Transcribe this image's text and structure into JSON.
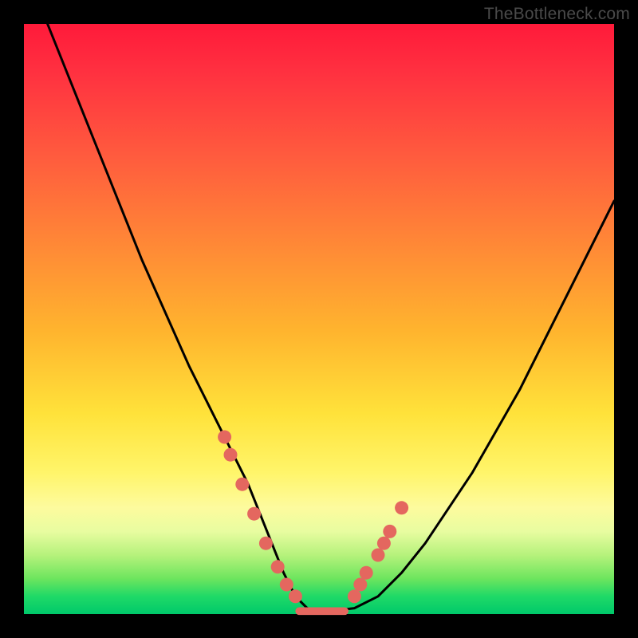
{
  "watermark": "TheBottleneck.com",
  "colors": {
    "frame_bg": "#000000",
    "gradient_top": "#ff1a3a",
    "gradient_bottom": "#00c96a",
    "curve": "#000000",
    "marker_fill": "#e4675f",
    "marker_stroke": "#c94e46",
    "bottom_band": "#e4675f"
  },
  "chart_data": {
    "type": "line",
    "title": "",
    "xlabel": "",
    "ylabel": "",
    "xlim": [
      0,
      100
    ],
    "ylim": [
      0,
      100
    ],
    "grid": false,
    "legend": false,
    "series": [
      {
        "name": "bottleneck-curve",
        "x": [
          4,
          8,
          12,
          16,
          20,
          24,
          28,
          30,
          32,
          34,
          36,
          38,
          40,
          42,
          44,
          46,
          48,
          50,
          52,
          56,
          60,
          64,
          68,
          72,
          76,
          80,
          84,
          88,
          92,
          96,
          100
        ],
        "y": [
          100,
          90,
          80,
          70,
          60,
          51,
          42,
          38,
          34,
          30,
          26,
          22,
          17,
          12,
          7,
          3,
          1,
          0.5,
          0.5,
          1,
          3,
          7,
          12,
          18,
          24,
          31,
          38,
          46,
          54,
          62,
          70
        ]
      }
    ],
    "markers": {
      "name": "highlight-dots",
      "points": [
        {
          "x": 34,
          "y": 30
        },
        {
          "x": 35,
          "y": 27
        },
        {
          "x": 37,
          "y": 22
        },
        {
          "x": 39,
          "y": 17
        },
        {
          "x": 41,
          "y": 12
        },
        {
          "x": 43,
          "y": 8
        },
        {
          "x": 44.5,
          "y": 5
        },
        {
          "x": 46,
          "y": 3
        },
        {
          "x": 56,
          "y": 3
        },
        {
          "x": 57,
          "y": 5
        },
        {
          "x": 58,
          "y": 7
        },
        {
          "x": 60,
          "y": 10
        },
        {
          "x": 61,
          "y": 12
        },
        {
          "x": 62,
          "y": 14
        },
        {
          "x": 64,
          "y": 18
        }
      ]
    },
    "bottom_band": {
      "x_start": 46,
      "x_end": 55,
      "y": 0.5,
      "thickness": 1.3
    }
  }
}
